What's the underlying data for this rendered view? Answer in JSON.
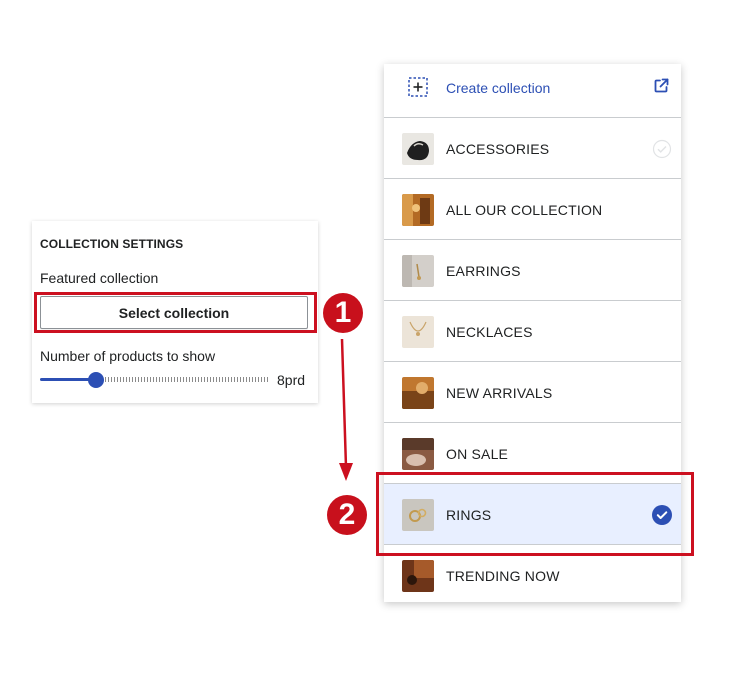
{
  "settings": {
    "heading": "COLLECTION SETTINGS",
    "featured_label": "Featured collection",
    "select_button": "Select collection",
    "products_label": "Number of products to show",
    "slider_value": "8prd",
    "slider_fraction": 0.24
  },
  "callouts": {
    "step1": "1",
    "step2": "2",
    "color": "#cc1020"
  },
  "picker": {
    "create_label": "Create collection",
    "accent": "#2c4fb4",
    "items": [
      {
        "label": "ACCESSORIES",
        "thumb_icon": "accessories-thumbnail",
        "state": "check-faint"
      },
      {
        "label": "ALL OUR COLLECTION",
        "thumb_icon": "collection-thumbnail",
        "state": "none"
      },
      {
        "label": "EARRINGS",
        "thumb_icon": "earrings-thumbnail",
        "state": "none"
      },
      {
        "label": "NECKLACES",
        "thumb_icon": "necklaces-thumbnail",
        "state": "none"
      },
      {
        "label": "NEW ARRIVALS",
        "thumb_icon": "new-arrivals-thumbnail",
        "state": "none"
      },
      {
        "label": "ON SALE",
        "thumb_icon": "on-sale-thumbnail",
        "state": "none"
      },
      {
        "label": "RINGS",
        "thumb_icon": "rings-thumbnail",
        "state": "selected"
      },
      {
        "label": "TRENDING NOW",
        "thumb_icon": "trending-thumbnail",
        "state": "none"
      }
    ]
  }
}
